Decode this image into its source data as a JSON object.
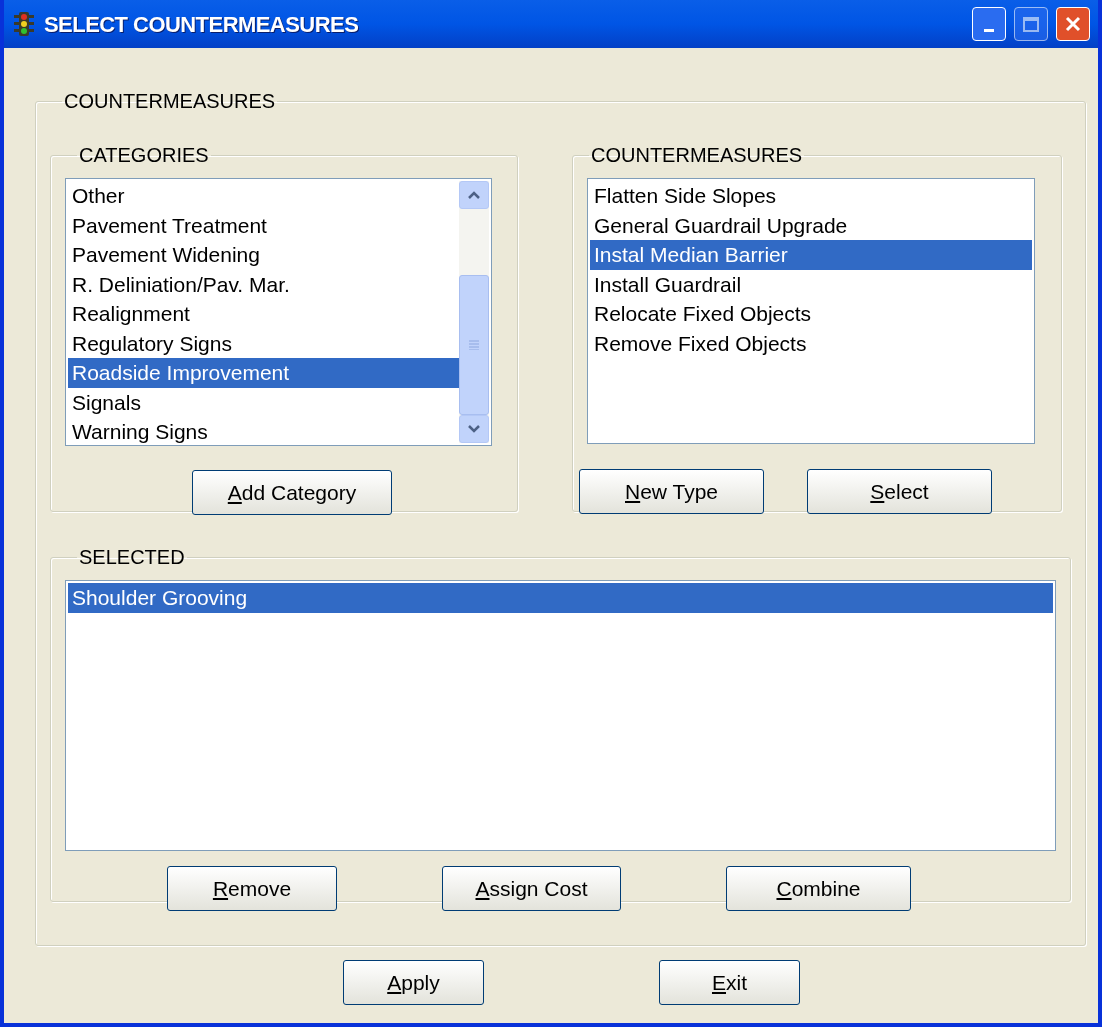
{
  "window": {
    "title": "SELECT COUNTERMEASURES"
  },
  "group_title": "COUNTERMEASURES",
  "categories": {
    "title": "CATEGORIES",
    "items": [
      {
        "label": "Other",
        "selected": false
      },
      {
        "label": "Pavement Treatment",
        "selected": false
      },
      {
        "label": "Pavement Widening",
        "selected": false
      },
      {
        "label": "R. Deliniation/Pav. Mar.",
        "selected": false
      },
      {
        "label": "Realignment",
        "selected": false
      },
      {
        "label": "Regulatory Signs",
        "selected": false
      },
      {
        "label": "Roadside Improvement",
        "selected": true
      },
      {
        "label": "Signals",
        "selected": false
      },
      {
        "label": "Warning Signs",
        "selected": false
      }
    ],
    "buttons": [
      {
        "label": "Add Category",
        "mnemonic": true
      }
    ]
  },
  "countermeasures": {
    "title": "COUNTERMEASURES",
    "items": [
      {
        "label": "Flatten Side Slopes",
        "selected": false
      },
      {
        "label": "General Guardrail Upgrade",
        "selected": false
      },
      {
        "label": "Instal Median Barrier",
        "selected": true
      },
      {
        "label": "Install Guardrail",
        "selected": false
      },
      {
        "label": "Relocate Fixed Objects",
        "selected": false
      },
      {
        "label": "Remove Fixed Objects",
        "selected": false
      }
    ],
    "buttons": [
      {
        "label": "New Type",
        "mnemonic": true
      },
      {
        "label": "Select",
        "mnemonic": true
      }
    ]
  },
  "selected": {
    "title": "SELECTED",
    "items": [
      {
        "label": "Shoulder Grooving",
        "selected": true
      }
    ],
    "buttons": [
      {
        "label": "Remove",
        "mnemonic": true
      },
      {
        "label": "Assign Cost",
        "mnemonic": true
      },
      {
        "label": "Combine",
        "mnemonic": true
      }
    ]
  },
  "buttons": [
    {
      "label": "Apply",
      "mnemonic": true
    },
    {
      "label": "Exit",
      "mnemonic": true
    }
  ]
}
